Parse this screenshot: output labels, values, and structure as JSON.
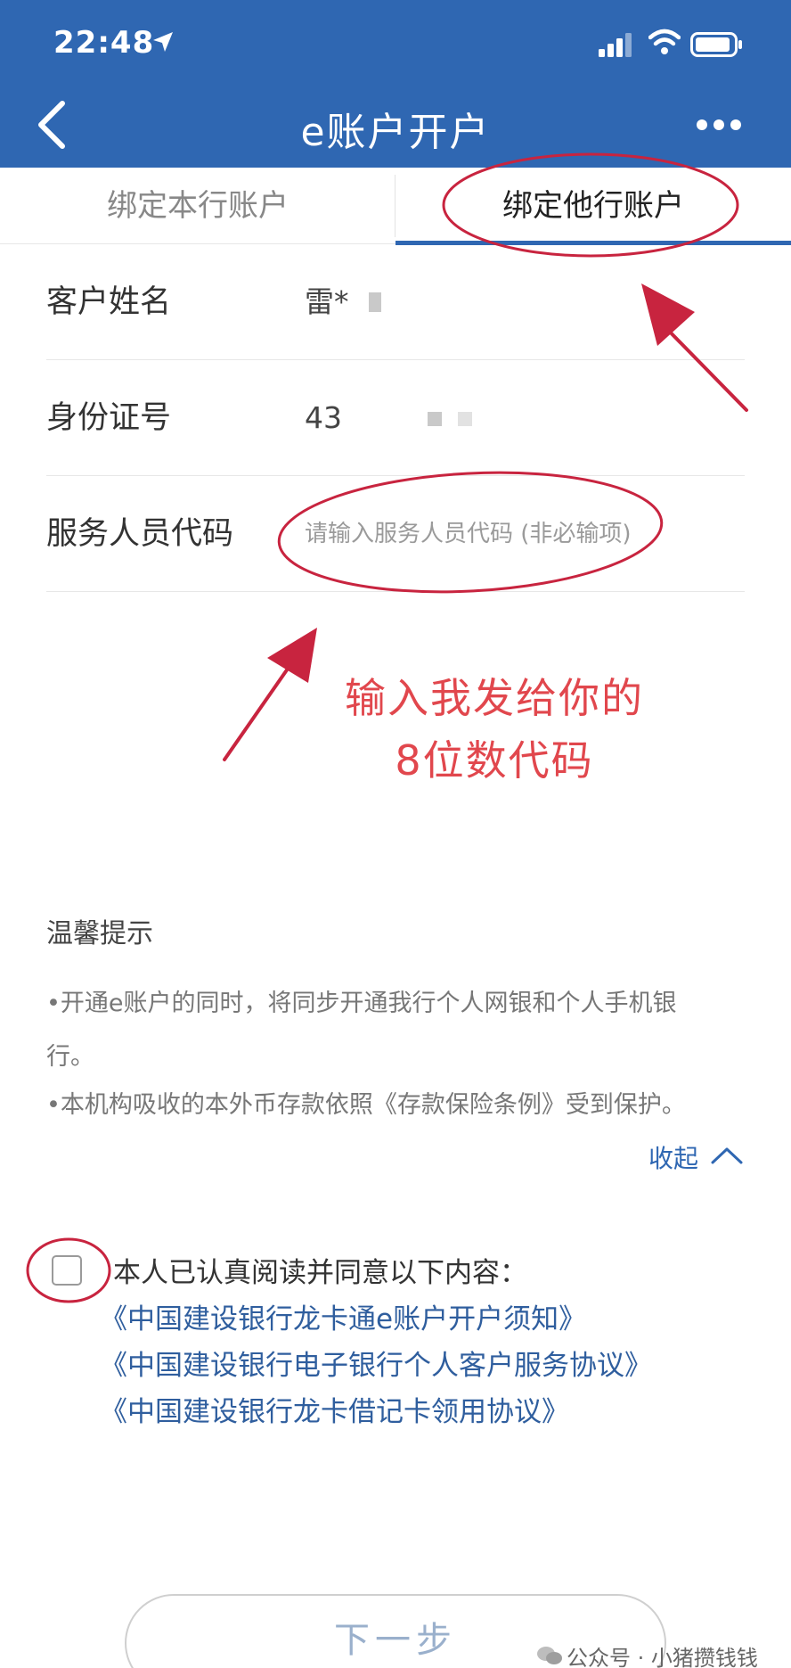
{
  "status": {
    "time": "22:48"
  },
  "header": {
    "title": "e账户开户"
  },
  "tabs": [
    {
      "label": "绑定本行账户"
    },
    {
      "label": "绑定他行账户"
    }
  ],
  "form": {
    "name_label": "客户姓名",
    "name_value": "雷*",
    "id_label": "身份证号",
    "id_value": "43",
    "staff_label": "服务人员代码",
    "staff_value": "",
    "staff_placeholder": "请输入服务人员代码 (非必输项)"
  },
  "annotation": {
    "line1": "输入我发给你的",
    "line2": "8位数代码",
    "color": "#e1474d"
  },
  "tips": {
    "title": "温馨提示",
    "line1": "•开通e账户的同时，将同步开通我行个人网银和个人手机银",
    "line2": "行。",
    "line3": "•本机构吸收的本外币存款依照《存款保险条例》受到保护。",
    "collapse_label": "收起"
  },
  "agreement": {
    "text": "本人已认真阅读并同意以下内容：",
    "links": [
      "《中国建设银行龙卡通e账户开户须知》",
      "《中国建设银行电子银行个人客户服务协议》",
      "《中国建设银行龙卡借记卡领用协议》"
    ]
  },
  "next_button": "下一步",
  "watermark": "公众号 · 小猪攒钱钱",
  "colors": {
    "primary": "#2f67b2",
    "annotation": "#c8243f"
  }
}
